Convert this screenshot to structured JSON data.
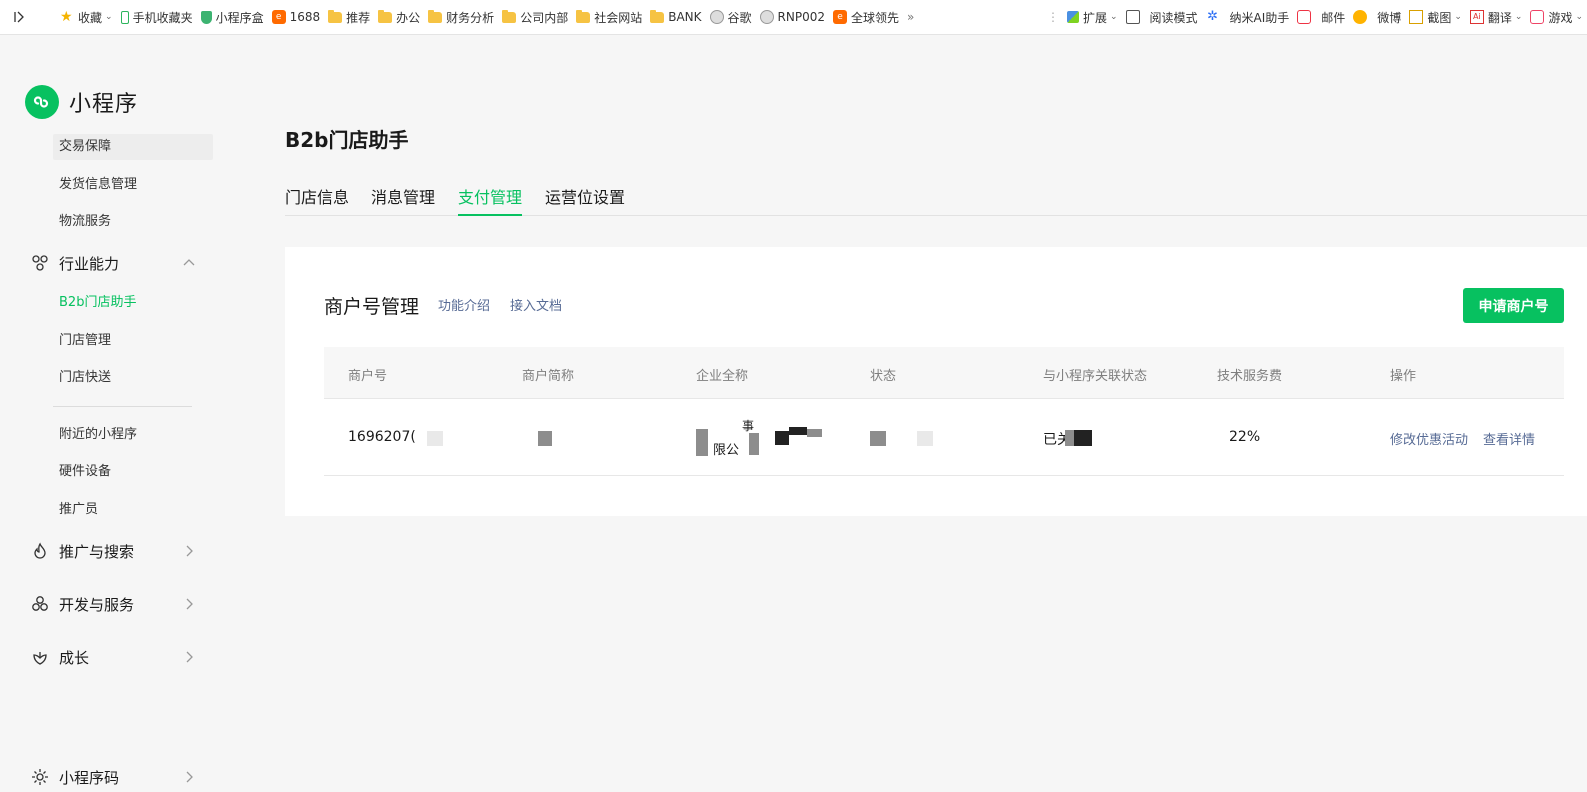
{
  "browser": {
    "bookmarks": [
      {
        "label": "收藏",
        "icon": "star-icon",
        "caret": true
      },
      {
        "label": "手机收藏夹",
        "icon": "phone-icon"
      },
      {
        "label": "小程序盒",
        "icon": "shield-icon"
      },
      {
        "label": "1688",
        "icon": "alibaba-icon"
      },
      {
        "label": "推荐",
        "icon": "folder-icon"
      },
      {
        "label": "办公",
        "icon": "folder-icon"
      },
      {
        "label": "财务分析",
        "icon": "folder-icon"
      },
      {
        "label": "公司内部",
        "icon": "folder-icon"
      },
      {
        "label": "社会网站",
        "icon": "folder-icon"
      },
      {
        "label": "BANK",
        "icon": "folder-icon"
      },
      {
        "label": "谷歌",
        "icon": "globe-icon"
      },
      {
        "label": "RNP002",
        "icon": "globe-icon"
      },
      {
        "label": "全球领先",
        "icon": "alibaba-icon"
      }
    ],
    "more_glyph": "»",
    "toolbar": {
      "extensions": "扩展",
      "reading_mode": "阅读模式",
      "nami_ai": "纳米AI助手",
      "mail": "邮件",
      "weibo": "微博",
      "screenshot": "截图",
      "translate": "翻译",
      "games": "游戏"
    }
  },
  "sidebar": {
    "brand": "小程序",
    "items_top": [
      "交易保障",
      "发货信息管理",
      "物流服务"
    ],
    "industry_group": "行业能力",
    "industry_items": [
      "B2b门店助手",
      "门店管理",
      "门店快送"
    ],
    "extra_items": [
      "附近的小程序",
      "硬件设备",
      "推广员"
    ],
    "groups": [
      "推广与搜索",
      "开发与服务",
      "成长"
    ],
    "bottom_item": "小程序码"
  },
  "main": {
    "title": "B2b门店助手",
    "tabs": [
      "门店信息",
      "消息管理",
      "支付管理",
      "运营位设置"
    ],
    "active_tab": "支付管理",
    "card": {
      "title": "商户号管理",
      "links": [
        "功能介绍",
        "接入文档"
      ],
      "apply_button": "申请商户号",
      "columns": [
        "商户号",
        "商户简称",
        "企业全称",
        "状态",
        "与小程序关联状态",
        "技术服务费",
        "操作"
      ],
      "row": {
        "merchant_id": "1696207(",
        "company_fragment_1": "事",
        "company_fragment_2": "限公",
        "link_status_prefix": "已关",
        "service_fee": "22%",
        "actions": [
          "修改优惠活动",
          "查看详情"
        ]
      }
    }
  },
  "colors": {
    "accent_green": "#07c160",
    "link_blue": "#576b95",
    "page_bg": "#f6f6f6"
  }
}
